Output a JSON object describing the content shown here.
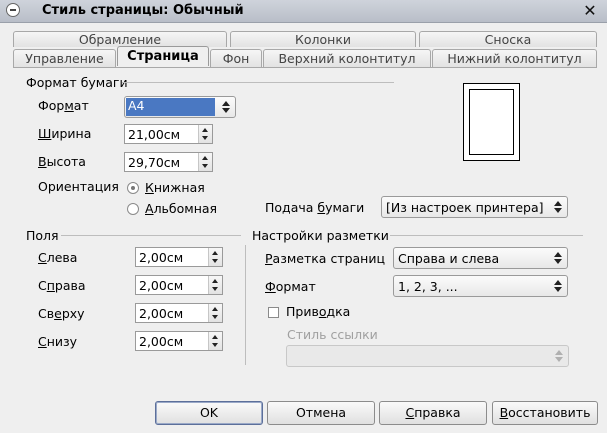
{
  "window": {
    "title": "Стиль страницы: Обычный",
    "close": "✕"
  },
  "tabs_row1": [
    "Обрамление",
    "Колонки",
    "Сноска"
  ],
  "tabs_row2": [
    "Управление",
    "Страница",
    "Фон",
    "Верхний колонтитул",
    "Нижний колонтитул"
  ],
  "active_tab": "Страница",
  "paper_format": {
    "header": "Формат бумаги",
    "format_label": "Формат",
    "format_value": "A4",
    "width_label": "Ширина",
    "width_value": "21,00см",
    "height_label": "Высота",
    "height_value": "29,70см",
    "orientation_label": "Ориентация",
    "portrait_label": "Книжная",
    "landscape_label": "Альбомная",
    "orientation_selected": "Книжная",
    "tray_label": "Подача бумаги",
    "tray_value": "[Из настроек принтера]"
  },
  "margins": {
    "header": "Поля",
    "left_label": "Слева",
    "left_value": "2,00см",
    "right_label": "Справа",
    "right_value": "2,00см",
    "top_label": "Сверху",
    "top_value": "2,00см",
    "bottom_label": "Снизу",
    "bottom_value": "2,00см"
  },
  "layout": {
    "header": "Настройки разметки",
    "page_layout_label": "Разметка страниц",
    "page_layout_value": "Справа и слева",
    "format_label": "Формат",
    "format_value": "1, 2, 3, ...",
    "register_label": "Приводка",
    "ref_style_label": "Стиль ссылки",
    "ref_style_value": ""
  },
  "buttons": {
    "ok": "OK",
    "cancel": "Отмена",
    "help": "Справка",
    "reset": "Восстановить"
  },
  "colors": {
    "selection": "#4a78c2",
    "titlebar": "#c4c8d0"
  }
}
